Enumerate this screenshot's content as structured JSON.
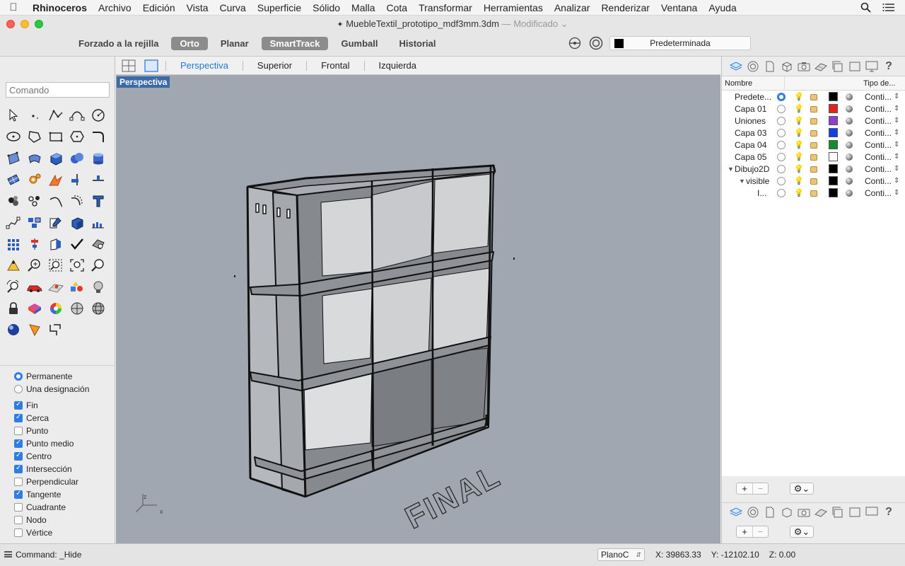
{
  "menubar": {
    "app": "Rhinoceros",
    "items": [
      "Archivo",
      "Edición",
      "Vista",
      "Curva",
      "Superficie",
      "Sólido",
      "Malla",
      "Cota",
      "Transformar",
      "Herramientas",
      "Analizar",
      "Renderizar",
      "Ventana",
      "Ayuda"
    ]
  },
  "window": {
    "title": "MuebleTextil_prototipo_mdf3mm.3dm",
    "modified": "— Modificado"
  },
  "toolbar": {
    "items": [
      {
        "label": "Forzado a la rejilla",
        "on": false
      },
      {
        "label": "Orto",
        "on": true
      },
      {
        "label": "Planar",
        "on": false
      },
      {
        "label": "SmartTrack",
        "on": true
      },
      {
        "label": "Gumball",
        "on": false
      },
      {
        "label": "Historial",
        "on": false
      }
    ],
    "layer_selector": "Predeterminada"
  },
  "command": {
    "placeholder": "Comando"
  },
  "viewport": {
    "tabs": [
      "Perspectiva",
      "Superior",
      "Frontal",
      "Izquierda"
    ],
    "active_tab": "Perspectiva",
    "label": "Perspectiva",
    "annotation_text": "FINAL",
    "axis_labels": {
      "x": "x",
      "z": "z"
    }
  },
  "snaps": {
    "mode": [
      {
        "label": "Permanente",
        "selected": true
      },
      {
        "label": "Una designación",
        "selected": false
      }
    ],
    "osnaps": [
      {
        "label": "Fin",
        "checked": true
      },
      {
        "label": "Cerca",
        "checked": true
      },
      {
        "label": "Punto",
        "checked": false
      },
      {
        "label": "Punto medio",
        "checked": true
      },
      {
        "label": "Centro",
        "checked": true
      },
      {
        "label": "Intersección",
        "checked": true
      },
      {
        "label": "Perpendicular",
        "checked": false
      },
      {
        "label": "Tangente",
        "checked": true
      },
      {
        "label": "Cuadrante",
        "checked": false
      },
      {
        "label": "Nodo",
        "checked": false
      },
      {
        "label": "Vértice",
        "checked": false
      }
    ]
  },
  "layers": {
    "headers": {
      "name": "Nombre",
      "linetype": "Tipo de..."
    },
    "rows": [
      {
        "name": "Predete...",
        "current": true,
        "color": "#000000",
        "linetype": "Conti..."
      },
      {
        "name": "Capa 01",
        "current": false,
        "color": "#e8201a",
        "linetype": "Conti..."
      },
      {
        "name": "Uniones",
        "current": false,
        "color": "#8e3fce",
        "linetype": "Conti..."
      },
      {
        "name": "Capa 03",
        "current": false,
        "color": "#1240e6",
        "linetype": "Conti..."
      },
      {
        "name": "Capa 04",
        "current": false,
        "color": "#148c2c",
        "linetype": "Conti..."
      },
      {
        "name": "Capa 05",
        "current": false,
        "color": "#ffffff",
        "linetype": "Conti..."
      },
      {
        "name": "Dibujo2D",
        "current": false,
        "color": "#000000",
        "linetype": "Conti..."
      },
      {
        "name": "visible",
        "current": false,
        "color": "#000000",
        "linetype": "Conti..."
      },
      {
        "name": "I...",
        "current": false,
        "color": "#000000",
        "linetype": "Conti..."
      }
    ]
  },
  "statusbar": {
    "command": "Command: _Hide",
    "plane": "PlanoC",
    "x": "X: 39863.33",
    "y": "Y: -12102.10",
    "z": "Z: 0.00"
  }
}
